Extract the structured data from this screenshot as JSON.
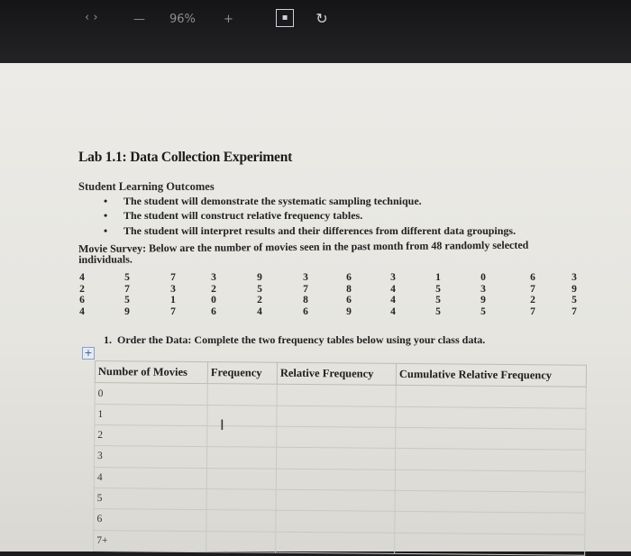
{
  "topbar": {
    "status_text": "96%",
    "add_icon": "plus-icon",
    "icons": [
      "minus-icon",
      "square-icon",
      "refresh-icon"
    ]
  },
  "document": {
    "title": "Lab 1.1: Data Collection Experiment",
    "outcomes_heading": "Student Learning Outcomes",
    "outcomes": [
      "The student will demonstrate the systematic sampling technique.",
      "The student will construct relative frequency tables.",
      "The student will interpret results and their differences from different data groupings."
    ],
    "survey_text": "Movie Survey: Below are the number of movies seen in the past month from 48 randomly selected individuals.",
    "data_columns": [
      [
        "4",
        "2",
        "6",
        "4"
      ],
      [
        "5",
        "7",
        "5",
        "9"
      ],
      [
        "7",
        "3",
        "1",
        "7"
      ],
      [
        "3",
        "2",
        "0",
        "6"
      ],
      [
        "9",
        "5",
        "2",
        "4"
      ],
      [
        "3",
        "7",
        "8",
        "6"
      ],
      [
        "6",
        "8",
        "6",
        "9"
      ],
      [
        "3",
        "4",
        "4",
        "4"
      ],
      [
        "1",
        "5",
        "5",
        "5"
      ],
      [
        "0",
        "3",
        "9",
        "5"
      ],
      [
        "6",
        "7",
        "2",
        "7"
      ],
      [
        "3",
        "9",
        "5",
        "7"
      ]
    ],
    "task_number": "1.",
    "task_text": "Order the Data: Complete the two frequency tables below using your class data.",
    "table": {
      "headers": [
        "Number of Movies",
        "Frequency",
        "Relative Frequency",
        "Cumulative Relative Frequency"
      ],
      "rows": [
        "0",
        "1",
        "2",
        "3",
        "4",
        "5",
        "6",
        "7+"
      ]
    }
  }
}
